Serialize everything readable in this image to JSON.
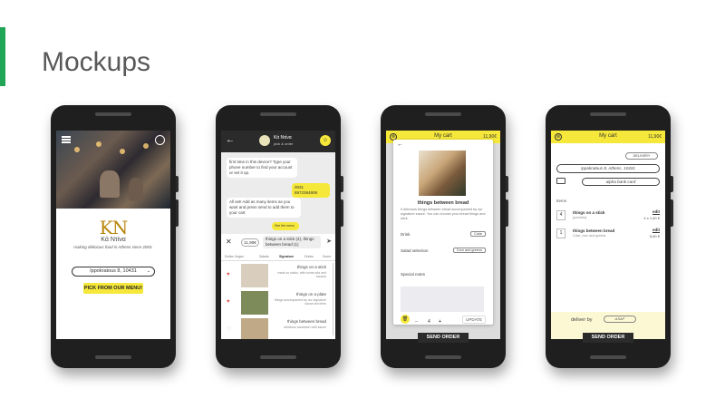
{
  "slide": {
    "title": "Mockups",
    "accent_color": "#21a557"
  },
  "phone1": {
    "logo": "KN",
    "name": "Kά Ντίνα",
    "tagline": "making delicious food in Athens since 2003.",
    "address": "Ippokratous 8, 10431",
    "pick_button": "PICK FROM OUR MENU!"
  },
  "phone2": {
    "header_title": "Κά Ντίνα",
    "header_sub": "pick & order",
    "bot_icon": "bot-icon",
    "chat": [
      {
        "text": "first time in this device? Type your phone number to find your account or set it up.",
        "me": false
      },
      {
        "text": "0031 6972384909",
        "me": true
      },
      {
        "text": "All set! Add as many items as you want and press send to add them to your cart",
        "me": false
      },
      {
        "text": "See the menu",
        "me": true
      }
    ],
    "price_chip": "11,90€",
    "message": "things on a stick (4), things between bread (1)",
    "tabs": [
      "Drinks Vegan",
      "Salads",
      "Signature",
      "Drinks",
      "Some"
    ],
    "items": [
      {
        "name": "things on a stick",
        "desc": "meat on sticks, with some pita and sauces"
      },
      {
        "name": "things on a plate",
        "desc": "things accompanied by our signature sauce and fries"
      },
      {
        "name": "things between bread",
        "desc": "delicious sandwich with sauce"
      }
    ]
  },
  "phone3": {
    "top_title": "My cart",
    "top_total": "11,90€",
    "item_name": "things between bread",
    "item_desc": "5 delicious things between bread accompanied by our signature sauce. You can choose your bread things and stick.",
    "drink_label": "Drink",
    "drink_value": "Coke",
    "salad_label": "Salad selection",
    "salad_value": "Corn and greens",
    "notes_label": "Special notes",
    "qty": "4",
    "minus": "−",
    "plus": "+",
    "update": "UPDATE",
    "send": "SEND ORDER"
  },
  "phone4": {
    "top_title": "My cart",
    "top_total": "11,90€",
    "delivery": "DELIVERY",
    "address": "Ippokratous 8, Athens, 10431",
    "card": "alpha bank card",
    "items_label": "Items",
    "lines": [
      {
        "qty": "4",
        "name": "things on a stick",
        "sub": "(pcs/ices)",
        "edit": "edit",
        "price": "4 x 1,60 €"
      },
      {
        "qty": "1",
        "name": "things between bread",
        "sub": "Coke, corn and greens",
        "edit": "edit",
        "price": "5,60 €"
      }
    ],
    "deliver_by": "deliver by",
    "asap": "ASAP",
    "send": "SEND ORDER"
  }
}
